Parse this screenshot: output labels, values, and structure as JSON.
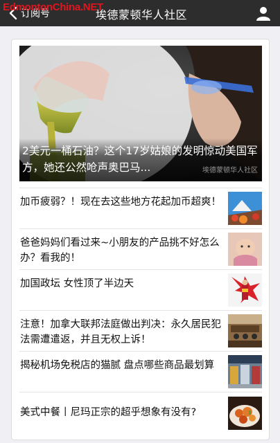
{
  "navbar": {
    "back_label": "订阅号",
    "title": "埃德蒙顿华人社区"
  },
  "watermark": "EdmontonChina.NET",
  "side_watermark": "EdmontonChina.NET",
  "hero": {
    "title": "2美元一桶石油？这个17岁姑娘的发明惊动美国军方，她还公然呛声奥巴马...",
    "image_watermark": "埃德蒙顿华人社区"
  },
  "articles": [
    {
      "title": "加币疲弱？！现在去这些地方花起加币超爽！",
      "thumb": "mountain-travel-image"
    },
    {
      "title": "爸爸妈妈们看过来~小朋友的产品挑不好怎么办？看我的！",
      "thumb": "baby-image"
    },
    {
      "title": "加国政坛 女性顶了半边天",
      "thumb": "wonder-woman-flag-image"
    },
    {
      "title": "注意！加拿大联邦法庭做出判决：永久居民犯法需遭遣返，并且无权上诉！",
      "thumb": "courtroom-image"
    },
    {
      "title": "揭秘机场免税店的猫腻 盘点哪些商品最划算",
      "thumb": "duty-free-shop-image"
    },
    {
      "title": "美式中餐丨尼玛正宗的超乎想象有没有?",
      "thumb": "chinese-food-image"
    }
  ]
}
